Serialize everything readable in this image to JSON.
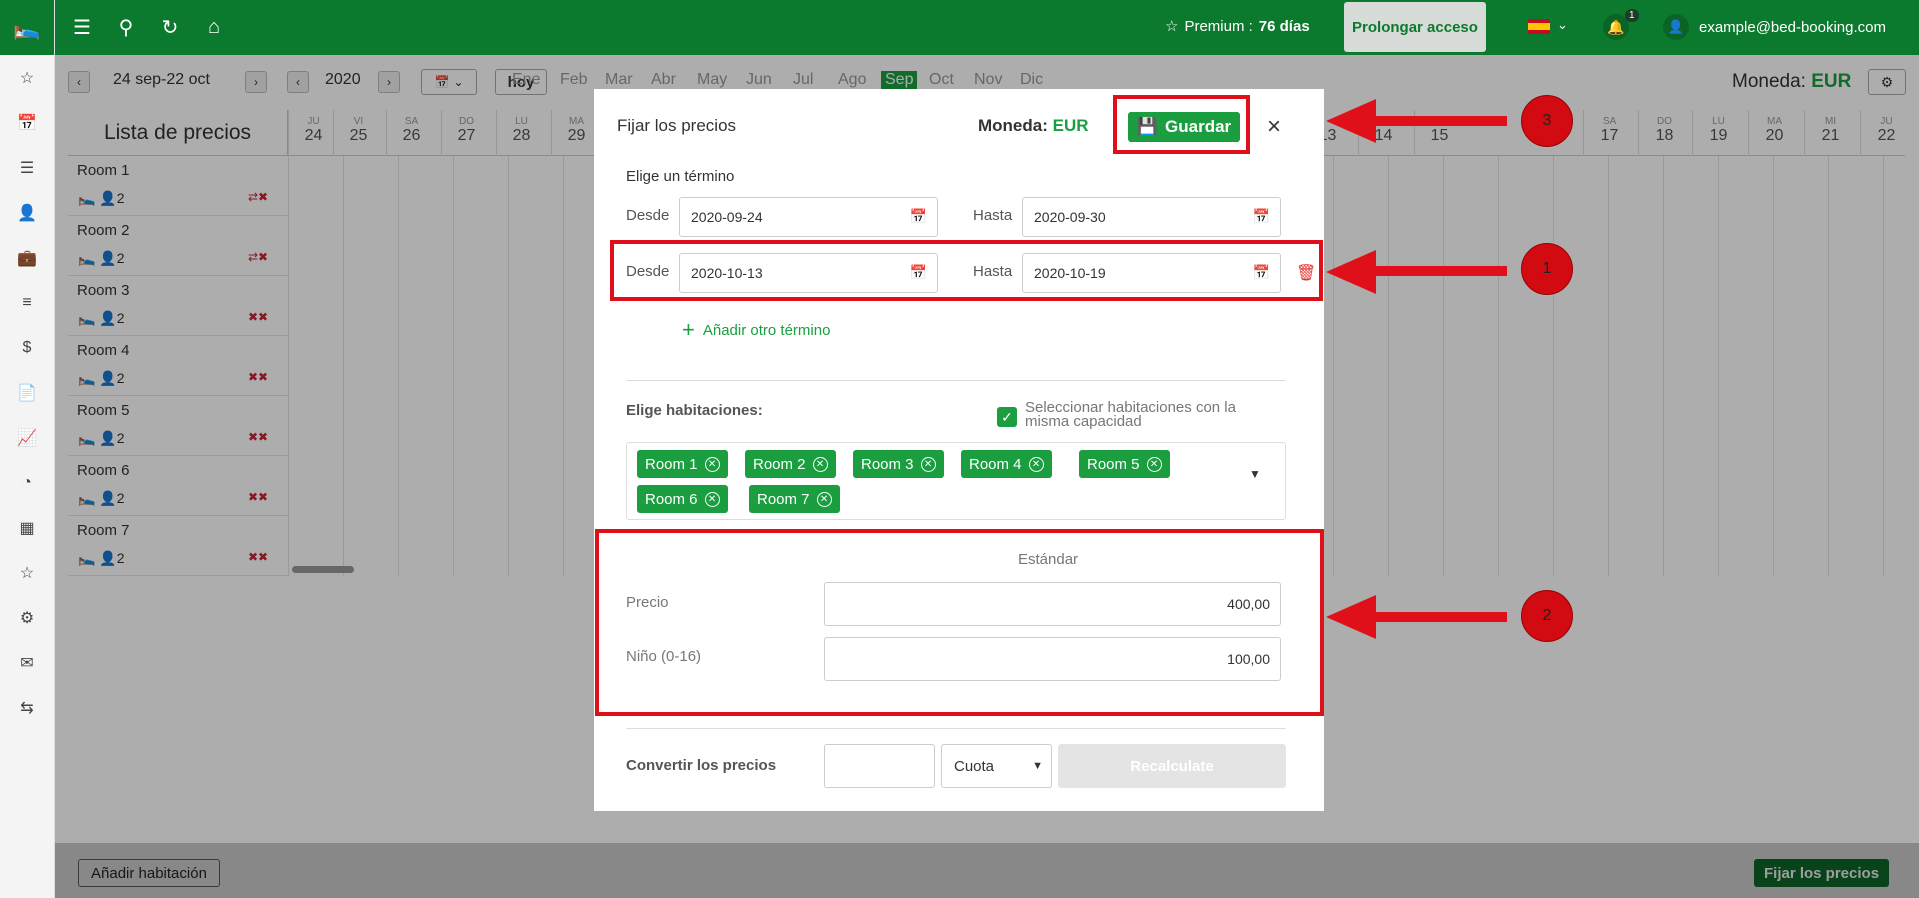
{
  "topbar": {
    "premium_label": "Premium :",
    "premium_days": "76 días",
    "prolongar_label": "Prolongar acceso",
    "notifications_count": "1",
    "user_email": "example@bed-booking.com"
  },
  "nav": {
    "date_range": "24 sep-22 oct",
    "year": "2020",
    "hoy_label": "hoy",
    "months": [
      "Ene",
      "Feb",
      "Mar",
      "Abr",
      "May",
      "Jun",
      "Jul",
      "Ago",
      "Sep",
      "Oct",
      "Nov",
      "Dic"
    ],
    "active_month": "Sep",
    "moneda_label": "Moneda:",
    "moneda_value": "EUR"
  },
  "grid": {
    "list_title": "Lista de precios",
    "days_left": [
      {
        "dow": "JU",
        "num": "24"
      },
      {
        "dow": "VI",
        "num": "25"
      },
      {
        "dow": "SA",
        "num": "26"
      },
      {
        "dow": "DO",
        "num": "27"
      },
      {
        "dow": "LU",
        "num": "28"
      },
      {
        "dow": "MA",
        "num": "29"
      }
    ],
    "days_right_nums": [
      "13",
      "14",
      "15"
    ],
    "days_right": [
      {
        "dow": "SA",
        "num": "17"
      },
      {
        "dow": "DO",
        "num": "18"
      },
      {
        "dow": "LU",
        "num": "19"
      },
      {
        "dow": "MA",
        "num": "20"
      },
      {
        "dow": "MI",
        "num": "21"
      },
      {
        "dow": "JU",
        "num": "22"
      }
    ],
    "rooms": [
      {
        "name": "Room 1",
        "capacity": "2"
      },
      {
        "name": "Room 2",
        "capacity": "2"
      },
      {
        "name": "Room 3",
        "capacity": "2"
      },
      {
        "name": "Room 4",
        "capacity": "2"
      },
      {
        "name": "Room 5",
        "capacity": "2"
      },
      {
        "name": "Room 6",
        "capacity": "2"
      },
      {
        "name": "Room 7",
        "capacity": "2"
      }
    ]
  },
  "footer": {
    "add_room_label": "Añadir habitación",
    "fijar_label": "Fijar los precios"
  },
  "modal": {
    "title": "Fijar los precios",
    "moneda_label": "Moneda:",
    "moneda_value": "EUR",
    "save_label": "Guardar",
    "term_label": "Elige un término",
    "terms": [
      {
        "desde_label": "Desde",
        "desde": "2020-09-24",
        "hasta_label": "Hasta",
        "hasta": "2020-09-30"
      },
      {
        "desde_label": "Desde",
        "desde": "2020-10-13",
        "hasta_label": "Hasta",
        "hasta": "2020-10-19"
      }
    ],
    "add_term_label": "Añadir otro término",
    "rooms_label": "Elige habitaciones:",
    "same_capacity_label": "Seleccionar habitaciones con la misma capacidad",
    "same_capacity_checked": true,
    "selected_rooms": [
      "Room 1",
      "Room 2",
      "Room 3",
      "Room 4",
      "Room 5",
      "Room 6",
      "Room 7"
    ],
    "standard_label": "Estándar",
    "precio_label": "Precio",
    "precio_value": "400,00",
    "nino_label": "Niño (0-16)",
    "nino_value": "100,00",
    "convert_label": "Convertir los precios",
    "convert_value": "",
    "cuota_label": "Cuota",
    "recalc_label": "Recalculate"
  },
  "annotations": {
    "badge_1": "1",
    "badge_2": "2",
    "badge_3": "3",
    "color": "#e0101a"
  },
  "colors": {
    "brand_green": "#0c7a2e",
    "accent_green": "#1a9e3f",
    "delete_red": "#e0322e"
  }
}
